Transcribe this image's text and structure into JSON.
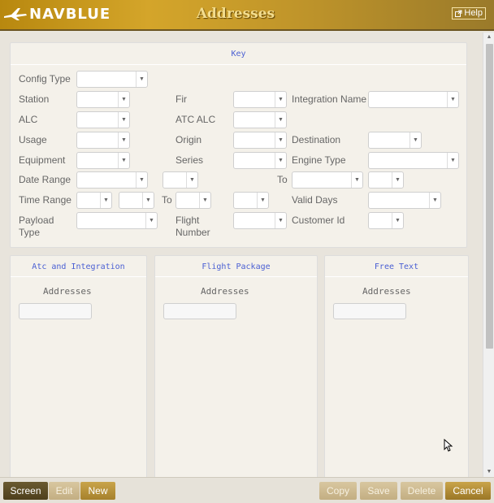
{
  "header": {
    "logo_text": "NAVBLUE",
    "title": "Addresses",
    "help_label": "Help"
  },
  "key_panel": {
    "title": "Key",
    "labels": {
      "config_type": "Config Type",
      "station": "Station",
      "fir": "Fir",
      "integration_name": "Integration Name",
      "alc": "ALC",
      "atc_alc": "ATC ALC",
      "usage": "Usage",
      "origin": "Origin",
      "destination": "Destination",
      "equipment": "Equipment",
      "series": "Series",
      "engine_type": "Engine Type",
      "date_range": "Date Range",
      "to1": "To",
      "time_range": "Time Range",
      "to2": "To",
      "valid_days": "Valid Days",
      "payload_type": "Payload Type",
      "flight_number": "Flight Number",
      "customer_id": "Customer Id"
    }
  },
  "panels": [
    {
      "title": "Atc and Integration",
      "field_label": "Addresses"
    },
    {
      "title": "Flight Package",
      "field_label": "Addresses"
    },
    {
      "title": "Free Text",
      "field_label": "Addresses"
    }
  ],
  "footer": {
    "screen": "Screen",
    "edit": "Edit",
    "new": "New",
    "copy": "Copy",
    "save": "Save",
    "delete": "Delete",
    "cancel": "Cancel"
  },
  "colors": {
    "brand_gold": "#c9a44a",
    "header_title": "#f3dd8e",
    "panel_title": "#4a5fd3"
  }
}
